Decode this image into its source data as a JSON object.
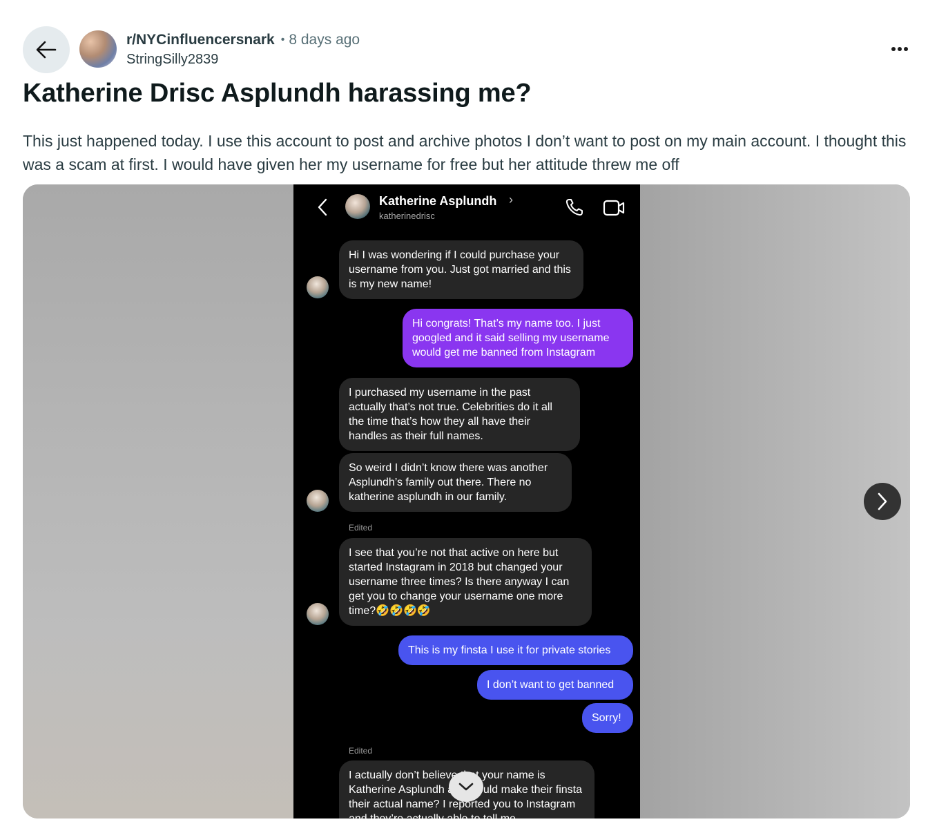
{
  "post": {
    "subreddit": "r/NYCinfluencersnark",
    "separator": "•",
    "time_ago": "8 days ago",
    "author": "StringSilly2839",
    "title": "Katherine Drisc Asplundh harassing me?",
    "body": "This just happened today. I use this account to post and archive photos I don’t want to post on my main account. I thought this was a scam at first. I would have given her my username for free but her attitude threw me off"
  },
  "screenshot": {
    "contact_name": "Katherine Asplundh",
    "contact_chevron": "›",
    "contact_handle": "katherinedrisc",
    "messages": [
      {
        "from": "them",
        "text": "Hi I was wondering if I could purchase your username from you. Just got married and this is my new name!"
      },
      {
        "from": "me",
        "text": "Hi congrats! That’s my name too. I just googled and it said selling my username would get me banned from Instagram"
      },
      {
        "from": "them",
        "text": "I purchased my username in the past actually that’s not true. Celebrities do it all the time that’s how they all have their handles as their full names."
      },
      {
        "from": "them",
        "text": "So weird I didn’t know there was another Asplundh’s family out there. There no katherine asplundh in our family."
      },
      {
        "from": "them",
        "text": "I see that you’re not that active on here but started Instagram in 2018 but changed your username three times? Is there anyway I can get you to change your username one more time?🤣🤣🤣🤣"
      },
      {
        "from": "me",
        "text": "This is my finsta I use it for private stories"
      },
      {
        "from": "me",
        "text": "I don’t want to get banned"
      },
      {
        "from": "me",
        "text": "Sorry!"
      },
      {
        "from": "them",
        "text": "I actually don’t believe that your name is Katherine Asplundh and would make their finsta their actual name? I reported you to Instagram and they’re actually able to tell me"
      }
    ],
    "edited_label": "Edited"
  },
  "icons": {
    "back": "arrow-left-icon",
    "more": "more-horizontal-icon",
    "next": "chevron-right-icon"
  }
}
